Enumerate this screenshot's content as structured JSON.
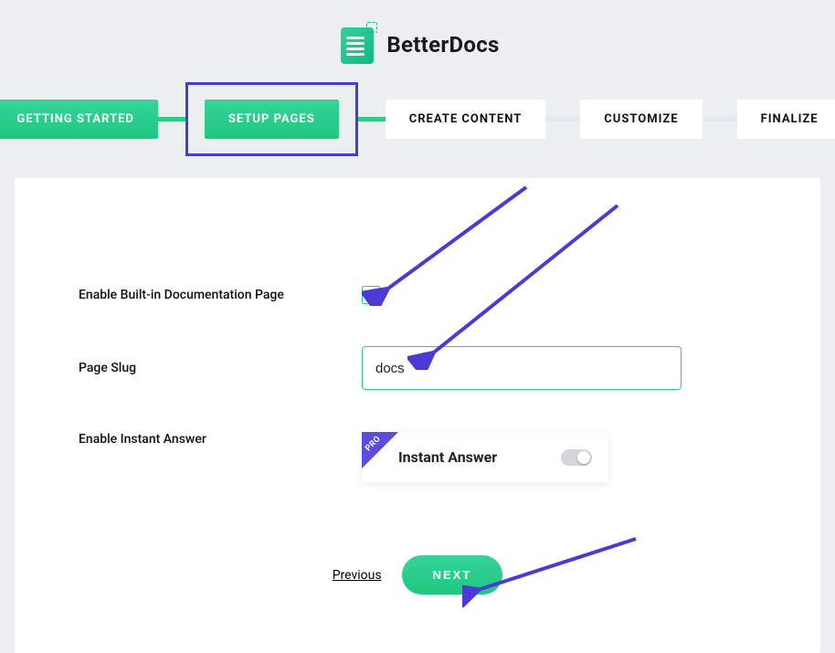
{
  "brand": {
    "name": "BetterDocs"
  },
  "steps": [
    {
      "label": "GETTING STARTED",
      "state": "active"
    },
    {
      "label": "SETUP PAGES",
      "state": "active-highlight"
    },
    {
      "label": "CREATE CONTENT",
      "state": "pending"
    },
    {
      "label": "CUSTOMIZE",
      "state": "pending"
    },
    {
      "label": "FINALIZE",
      "state": "pending"
    }
  ],
  "form": {
    "enable_doc_page": {
      "label": "Enable Built-in Documentation Page",
      "checked": true
    },
    "page_slug": {
      "label": "Page Slug",
      "value": "docs"
    },
    "instant_answer": {
      "label": "Enable Instant Answer",
      "card_title": "Instant Answer",
      "pro_badge": "PRO",
      "enabled": false
    }
  },
  "nav": {
    "previous_label": "Previous",
    "next_label": "NEXT"
  }
}
